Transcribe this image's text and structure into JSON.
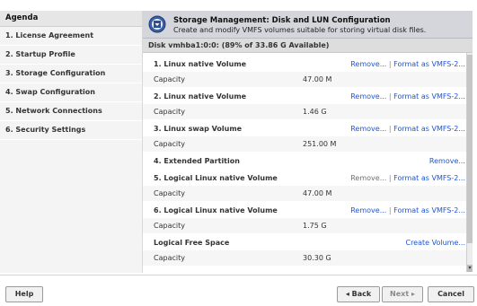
{
  "agenda": {
    "title": "Agenda",
    "items": [
      {
        "label": "1. License Agreement"
      },
      {
        "label": "2. Startup Profile"
      },
      {
        "label": "3. Storage Configuration"
      },
      {
        "label": "4. Swap Configuration"
      },
      {
        "label": "5. Network Connections"
      },
      {
        "label": "6. Security Settings"
      }
    ]
  },
  "banner": {
    "title": "Storage Management: Disk and LUN Configuration",
    "subtitle": "Create and modify VMFS volumes suitable for storing virtual disk files.",
    "icon": "storage-icon"
  },
  "disk_header": "Disk vmhba1:0:0: (89% of 33.86 G Available)",
  "capacity_label": "Capacity",
  "actions": {
    "remove": "Remove...",
    "format": "Format as VMFS-2...",
    "create": "Create Volume...",
    "separator": "|"
  },
  "partitions": [
    {
      "title": "1. Linux native Volume",
      "capacity": "47.00 M"
    },
    {
      "title": "2. Linux native Volume",
      "capacity": "1.46 G"
    },
    {
      "title": "3. Linux swap Volume",
      "capacity": "251.00 M"
    },
    {
      "title": "4. Extended Partition"
    },
    {
      "title": "5. Logical Linux native Volume",
      "capacity": "47.00 M"
    },
    {
      "title": "6. Logical Linux native Volume",
      "capacity": "1.75 G"
    },
    {
      "title": "Logical Free Space",
      "capacity": "30.30 G"
    }
  ],
  "footer": {
    "help": "Help",
    "back": "◂ Back",
    "next": "Next ▸",
    "cancel": "Cancel"
  }
}
